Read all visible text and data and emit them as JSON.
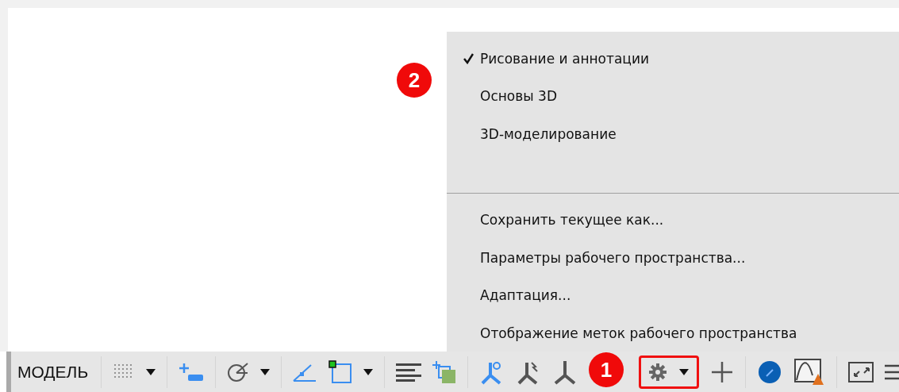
{
  "menu": {
    "items": [
      {
        "kind": "option",
        "label": "Рисование и аннотации",
        "checked": true
      },
      {
        "kind": "option",
        "label": "Основы 3D",
        "checked": false
      },
      {
        "kind": "option",
        "label": "3D-моделирование",
        "checked": false
      },
      {
        "kind": "gap"
      },
      {
        "kind": "separator"
      },
      {
        "kind": "command",
        "label": "Сохранить текущее как..."
      },
      {
        "kind": "command",
        "label": "Параметры рабочего пространства..."
      },
      {
        "kind": "command",
        "label": "Адаптация..."
      },
      {
        "kind": "command",
        "label": "Отображение меток рабочего пространства"
      }
    ]
  },
  "status_bar": {
    "model_label": "МОДЕЛЬ"
  },
  "callouts": [
    "1",
    "2"
  ]
}
